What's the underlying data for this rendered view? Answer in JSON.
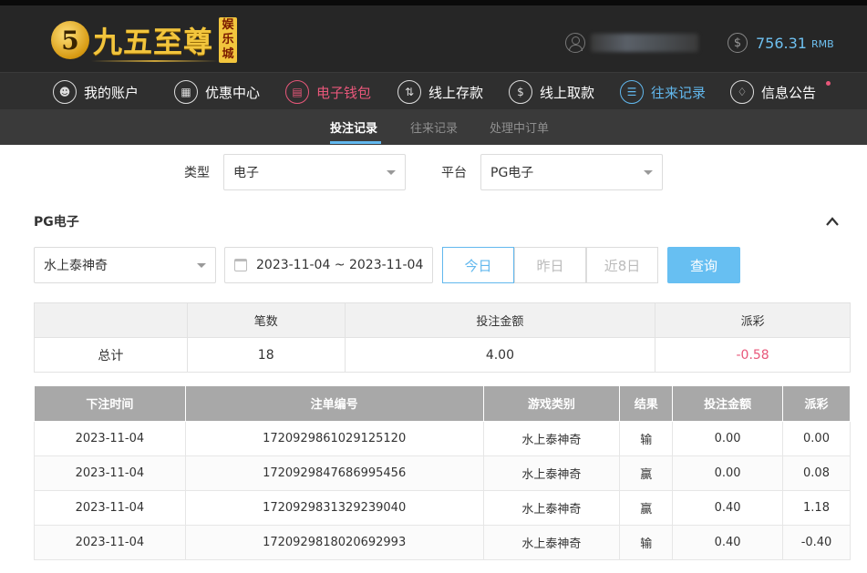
{
  "brand": {
    "name": "九五至尊",
    "badge": "5",
    "stamp": [
      "娱",
      "乐",
      "城"
    ]
  },
  "account": {
    "balance": "756.31",
    "unit": "RMB"
  },
  "nav": [
    {
      "label": "我的账户",
      "icon": "user-icon"
    },
    {
      "label": "优惠中心",
      "icon": "gift-icon"
    },
    {
      "label": "电子钱包",
      "icon": "wallet-icon",
      "state": "pink"
    },
    {
      "label": "线上存款",
      "icon": "deposit-icon"
    },
    {
      "label": "线上取款",
      "icon": "withdraw-icon"
    },
    {
      "label": "往来记录",
      "icon": "records-icon",
      "state": "active"
    },
    {
      "label": "信息公告",
      "icon": "bell-icon"
    }
  ],
  "subnav": [
    "投注记录",
    "往来记录",
    "处理中订单"
  ],
  "filters": {
    "type_label": "类型",
    "type_value": "电子",
    "platform_label": "平台",
    "platform_value": "PG电子"
  },
  "section": {
    "title": "PG电子"
  },
  "query": {
    "game": "水上泰神奇",
    "date_range": "2023-11-04 ~ 2023-11-04",
    "quick": [
      "今日",
      "昨日",
      "近8日"
    ],
    "button": "查询"
  },
  "summary": {
    "headers": [
      "",
      "笔数",
      "投注金额",
      "派彩"
    ],
    "row": {
      "label": "总计",
      "count": "18",
      "bet": "4.00",
      "payout": "-0.58"
    }
  },
  "records": {
    "headers": [
      "下注时间",
      "注单编号",
      "游戏类别",
      "结果",
      "投注金额",
      "派彩"
    ],
    "rows": [
      [
        "2023-11-04",
        "1720929861029125120",
        "水上泰神奇",
        "输",
        "0.00",
        "0.00"
      ],
      [
        "2023-11-04",
        "1720929847686995456",
        "水上泰神奇",
        "赢",
        "0.00",
        "0.08"
      ],
      [
        "2023-11-04",
        "1720929831329239040",
        "水上泰神奇",
        "赢",
        "0.40",
        "1.18"
      ],
      [
        "2023-11-04",
        "1720929818020692993",
        "水上泰神奇",
        "输",
        "0.40",
        "-0.40"
      ]
    ]
  },
  "colors": {
    "accent": "#62b8ee",
    "pink": "#e8577a",
    "gold": "#f2c53d"
  }
}
